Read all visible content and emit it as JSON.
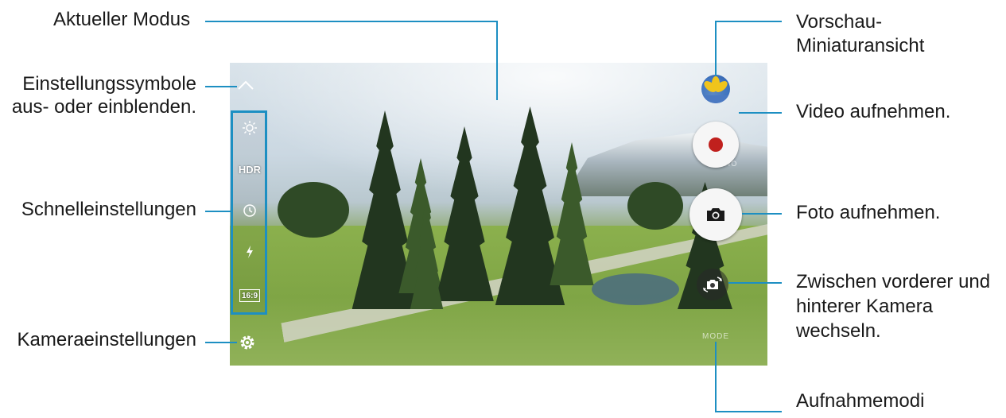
{
  "callouts": {
    "current_mode": "Aktueller Modus",
    "toggle_settings_line1": "Einstellungssymbole",
    "toggle_settings_line2": "aus- oder einblenden.",
    "quick_settings": "Schnelleinstellungen",
    "camera_settings": "Kameraeinstellungen",
    "preview_thumbnail_line1": "Vorschau-",
    "preview_thumbnail_line2": "Miniaturansicht",
    "record_video": "Video aufnehmen.",
    "take_photo": "Foto aufnehmen.",
    "switch_camera_line1": "Zwischen vorderer und",
    "switch_camera_line2": "hinterer Kamera",
    "switch_camera_line3": "wechseln.",
    "shooting_modes": "Aufnahmemodi"
  },
  "quick_settings": {
    "hdr_label": "HDR",
    "ratio_label": "16:9"
  },
  "icons": {
    "toggle": "chevron-up-icon",
    "brightness": "sun-icon",
    "timer": "timer-icon",
    "flash": "flash-icon",
    "settings": "gear-icon",
    "video": "record-icon",
    "photo": "camera-icon",
    "switch": "switch-camera-icon",
    "thumbnail": "gallery-thumbnail-icon"
  },
  "colors": {
    "leader_line": "#1d8fc2",
    "record_red": "#c0201d"
  }
}
